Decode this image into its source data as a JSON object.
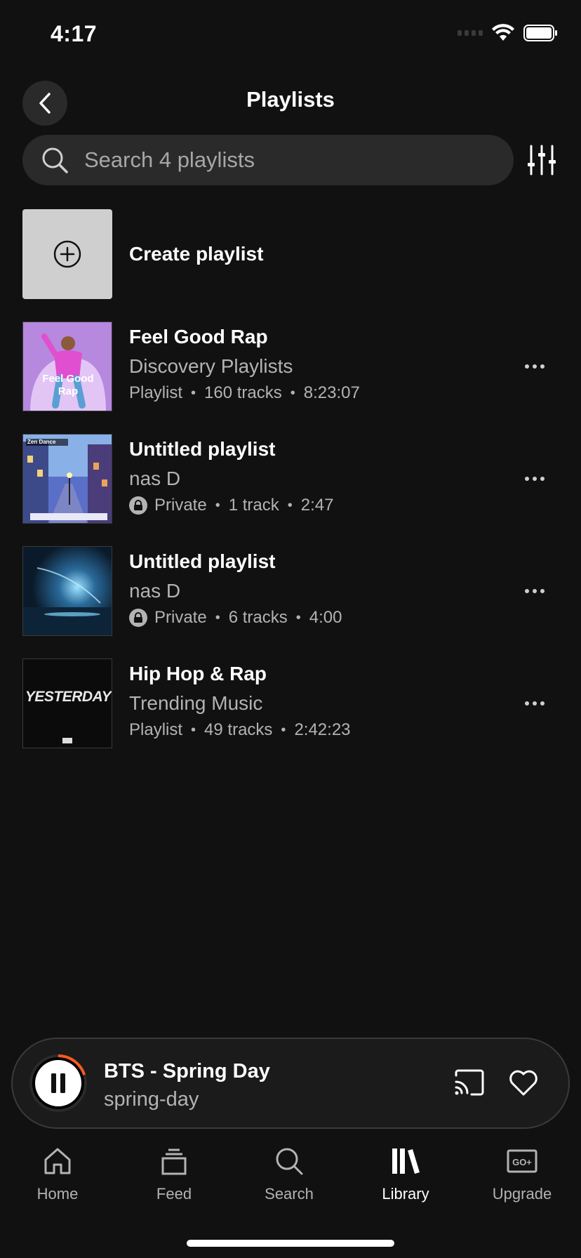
{
  "status_bar": {
    "time": "4:17"
  },
  "header": {
    "title": "Playlists"
  },
  "search": {
    "placeholder": "Search 4 playlists"
  },
  "create": {
    "label": "Create playlist"
  },
  "playlists": [
    {
      "title": "Feel Good Rap",
      "subtitle": "Discovery Playlists",
      "type": "Playlist",
      "private": false,
      "tracks": "160 tracks",
      "duration": "8:23:07",
      "art_text": "Feel Good Rap"
    },
    {
      "title": "Untitled playlist",
      "subtitle": "nas D",
      "type": "Private",
      "private": true,
      "tracks": "1 track",
      "duration": "2:47",
      "art_text": "Zen Dance"
    },
    {
      "title": "Untitled playlist",
      "subtitle": "nas D",
      "type": "Private",
      "private": true,
      "tracks": "6 tracks",
      "duration": "4:00",
      "art_text": ""
    },
    {
      "title": "Hip Hop & Rap",
      "subtitle": "Trending Music",
      "type": "Playlist",
      "private": false,
      "tracks": "49 tracks",
      "duration": "2:42:23",
      "art_text": "YESTERDAY"
    }
  ],
  "now_playing": {
    "title": "BTS - Spring Day",
    "artist": "spring-day",
    "progress": 0.2,
    "accent_color": "#ff5a1f"
  },
  "tabs": [
    {
      "label": "Home",
      "icon": "home-icon",
      "active": false
    },
    {
      "label": "Feed",
      "icon": "feed-icon",
      "active": false
    },
    {
      "label": "Search",
      "icon": "search-icon",
      "active": false
    },
    {
      "label": "Library",
      "icon": "library-icon",
      "active": true
    },
    {
      "label": "Upgrade",
      "icon": "upgrade-icon",
      "active": false
    }
  ]
}
